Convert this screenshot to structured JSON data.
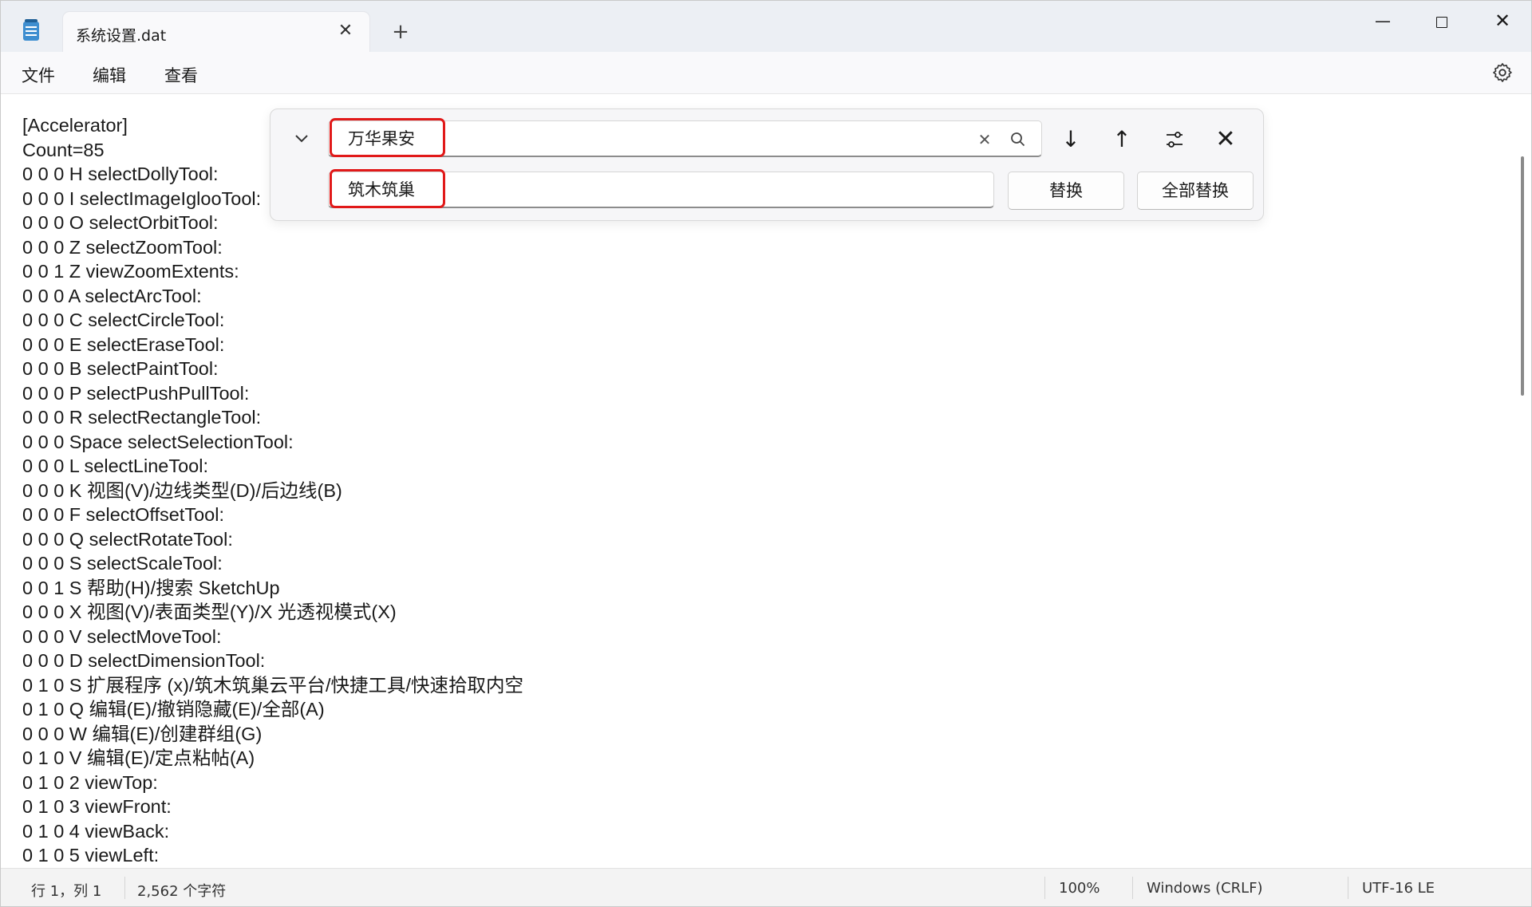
{
  "window": {
    "tab_title": "系统设置.dat",
    "tab_close": "✕",
    "new_tab": "+",
    "minimize": "—",
    "close": "✕"
  },
  "menu": {
    "file": "文件",
    "edit": "编辑",
    "view": "查看"
  },
  "find_panel": {
    "find_value": "万华果安",
    "replace_value": "筑木筑巢",
    "clear": "✕",
    "prev_arrow": "↓",
    "next_arrow": "↑",
    "close": "✕",
    "replace_label": "替换",
    "replace_all_label": "全部替换",
    "highlight_color": "#e11919"
  },
  "lines": [
    "[Accelerator]",
    "Count=85",
    "0 0 0 H selectDollyTool:",
    "0 0 0 I selectImageIglooTool:",
    "0 0 0 O selectOrbitTool:",
    "0 0 0 Z selectZoomTool:",
    "0 0 1 Z viewZoomExtents:",
    "0 0 0 A selectArcTool:",
    "0 0 0 C selectCircleTool:",
    "0 0 0 E selectEraseTool:",
    "0 0 0 B selectPaintTool:",
    "0 0 0 P selectPushPullTool:",
    "0 0 0 R selectRectangleTool:",
    "0 0 0 Space selectSelectionTool:",
    "0 0 0 L selectLineTool:",
    "0 0 0 K 视图(V)/边线类型(D)/后边线(B)",
    "0 0 0 F selectOffsetTool:",
    "0 0 0 Q selectRotateTool:",
    "0 0 0 S selectScaleTool:",
    "0 0 1 S 帮助(H)/搜索 SketchUp",
    "0 0 0 X 视图(V)/表面类型(Y)/X 光透视模式(X)",
    "0 0 0 V selectMoveTool:",
    "0 0 0 D selectDimensionTool:",
    "0 1 0 S 扩展程序 (x)/筑木筑巢云平台/快捷工具/快速拾取内空",
    "0 1 0 Q 编辑(E)/撤销隐藏(E)/全部(A)",
    "0 0 0 W 编辑(E)/创建群组(G)",
    "0 1 0 V 编辑(E)/定点粘帖(A)",
    "0 1 0 2 viewTop:",
    "0 1 0 3 viewFront:",
    "0 1 0 4 viewBack:",
    "0 1 0 5 viewLeft:"
  ],
  "status": {
    "position": "行 1，列 1",
    "chars": "2,562 个字符",
    "zoom": "100%",
    "line_ending": "Windows (CRLF)",
    "encoding": "UTF-16 LE"
  }
}
